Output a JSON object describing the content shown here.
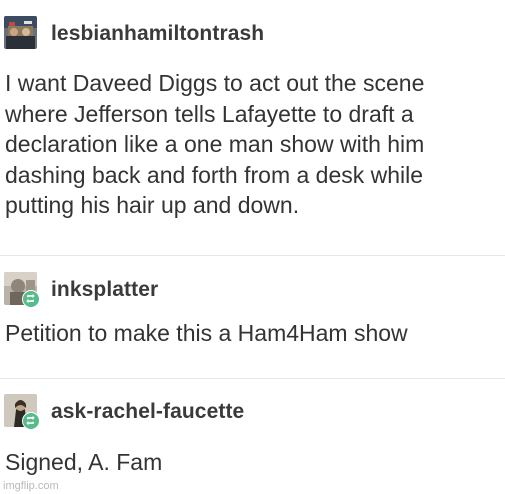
{
  "posts": [
    {
      "username": "lesbianhamiltontrash",
      "avatar_icon": "user-avatar-icon",
      "reblogged": false,
      "lines": [
        "I want Daveed Diggs to act out the scene",
        "where Jefferson tells Lafayette to draft a",
        "declaration like a one man show with him",
        "dashing back and forth from a desk while",
        "putting his hair up and down."
      ]
    },
    {
      "username": "inksplatter",
      "avatar_icon": "user-avatar-icon",
      "reblogged": true,
      "lines": [
        "Petition to make this a Ham4Ham show"
      ]
    },
    {
      "username": "ask-rachel-faucette",
      "avatar_icon": "user-avatar-icon",
      "reblogged": true,
      "lines": [
        "Signed, A. Fam"
      ]
    }
  ],
  "watermark": "imgflip.com",
  "colors": {
    "reblog_badge": "#56bc8a",
    "text": "#333333",
    "divider": "#e6e6e6"
  }
}
